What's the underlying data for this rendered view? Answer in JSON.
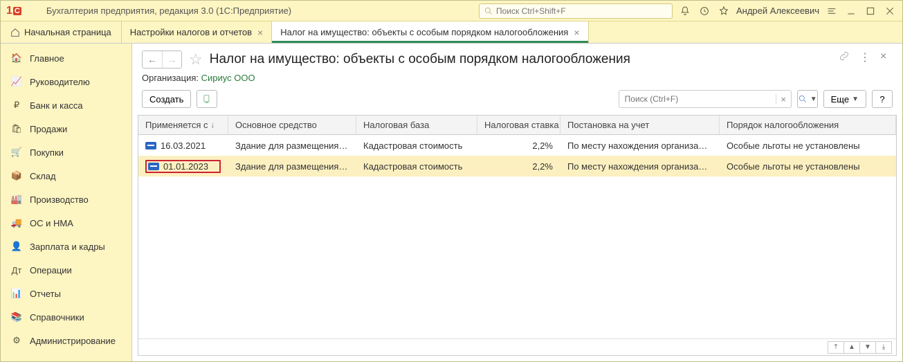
{
  "titlebar": {
    "app_title": "Бухгалтерия предприятия, редакция 3.0  (1С:Предприятие)",
    "search_placeholder": "Поиск Ctrl+Shift+F",
    "user": "Андрей Алексеевич"
  },
  "tabs": {
    "home": "Начальная страница",
    "t1": "Настройки налогов и отчетов",
    "t2": "Налог на имущество: объекты с особым порядком налогообложения"
  },
  "sidebar": {
    "items": [
      "Главное",
      "Руководителю",
      "Банк и касса",
      "Продажи",
      "Покупки",
      "Склад",
      "Производство",
      "ОС и НМА",
      "Зарплата и кадры",
      "Операции",
      "Отчеты",
      "Справочники",
      "Администрирование"
    ]
  },
  "page": {
    "title": "Налог на имущество: объекты с особым порядком налогообложения",
    "org_label": "Организация:",
    "org_value": "Сириус ООО"
  },
  "toolbar": {
    "create": "Создать",
    "search_placeholder": "Поиск (Ctrl+F)",
    "more": "Еще",
    "help": "?"
  },
  "table": {
    "headers": {
      "date": "Применяется с",
      "asset": "Основное средство",
      "base": "Налоговая база",
      "rate": "Налоговая ставка",
      "reg": "Постановка на учет",
      "order": "Порядок налогообложения"
    },
    "rows": [
      {
        "date": "16.03.2021",
        "asset": "Здание для размещения…",
        "base": "Кадастровая стоимость",
        "rate": "2,2%",
        "reg": "По месту нахождения организации",
        "order": "Особые льготы не установлены",
        "sel": false
      },
      {
        "date": "01.01.2023",
        "asset": "Здание для размещения…",
        "base": "Кадастровая стоимость",
        "rate": "2,2%",
        "reg": "По месту нахождения организации",
        "order": "Особые льготы не установлены",
        "sel": true
      }
    ]
  }
}
